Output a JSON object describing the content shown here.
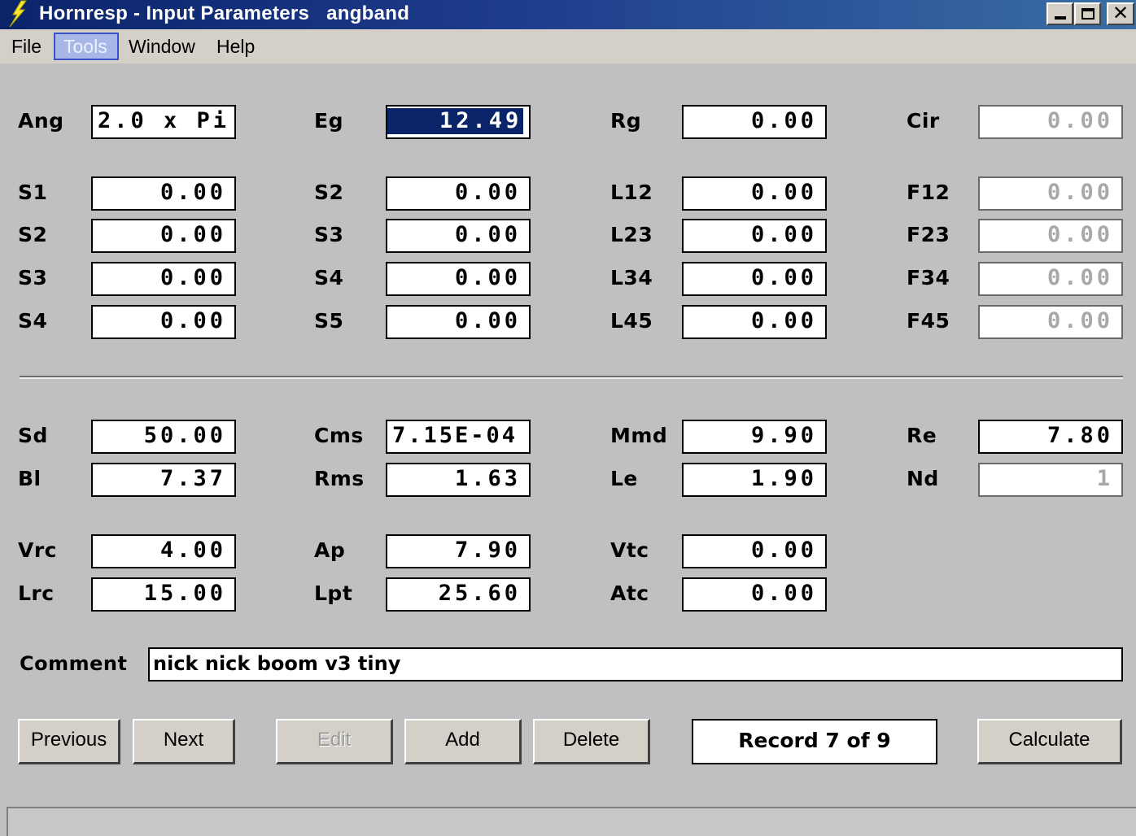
{
  "window": {
    "title": "Hornresp - Input Parameters   angband",
    "controls": {
      "minimize": "_",
      "maximize": "□",
      "close": "✕"
    }
  },
  "menu": {
    "items": [
      "File",
      "Tools",
      "Window",
      "Help"
    ],
    "active": "Tools"
  },
  "fields": {
    "Ang": "2.0 x Pi",
    "Eg": "12.49",
    "Rg": "0.00",
    "Cir": "0.00",
    "S1": "0.00",
    "S2a": "0.00",
    "L12": "0.00",
    "F12": "0.00",
    "S2b": "0.00",
    "S3a": "0.00",
    "L23": "0.00",
    "F23": "0.00",
    "S3b": "0.00",
    "S4a": "0.00",
    "L34": "0.00",
    "F34": "0.00",
    "S4b": "0.00",
    "S5": "0.00",
    "L45": "0.00",
    "F45": "0.00",
    "Sd": "50.00",
    "Cms": "7.15E-04",
    "Mmd": "9.90",
    "Re": "7.80",
    "Bl": "7.37",
    "Rms": "1.63",
    "Le": "1.90",
    "Nd": "1",
    "Vrc": "4.00",
    "Ap": "7.90",
    "Vtc": "0.00",
    "Lrc": "15.00",
    "Lpt": "25.60",
    "Atc": "0.00"
  },
  "labels": {
    "Ang": "Ang",
    "Eg": "Eg",
    "Rg": "Rg",
    "Cir": "Cir",
    "S1": "S1",
    "S2a": "S2",
    "L12": "L12",
    "F12": "F12",
    "S2b": "S2",
    "S3a": "S3",
    "L23": "L23",
    "F23": "F23",
    "S3b": "S3",
    "S4a": "S4",
    "L34": "L34",
    "F34": "F34",
    "S4b": "S4",
    "S5": "S5",
    "L45": "L45",
    "F45": "F45",
    "Sd": "Sd",
    "Cms": "Cms",
    "Mmd": "Mmd",
    "Re": "Re",
    "Bl": "Bl",
    "Rms": "Rms",
    "Le": "Le",
    "Nd": "Nd",
    "Vrc": "Vrc",
    "Ap": "Ap",
    "Vtc": "Vtc",
    "Lrc": "Lrc",
    "Lpt": "Lpt",
    "Atc": "Atc"
  },
  "comment": {
    "label": "Comment",
    "value": "nick nick boom v3 tiny"
  },
  "buttons": {
    "previous": "Previous",
    "next": "Next",
    "edit": "Edit",
    "add": "Add",
    "delete": "Delete",
    "calculate": "Calculate"
  },
  "record_status": "Record 7 of 9",
  "colors": {
    "titlebar": "#0a246a",
    "selection": "#0a246a",
    "face": "#c0c0c0"
  }
}
